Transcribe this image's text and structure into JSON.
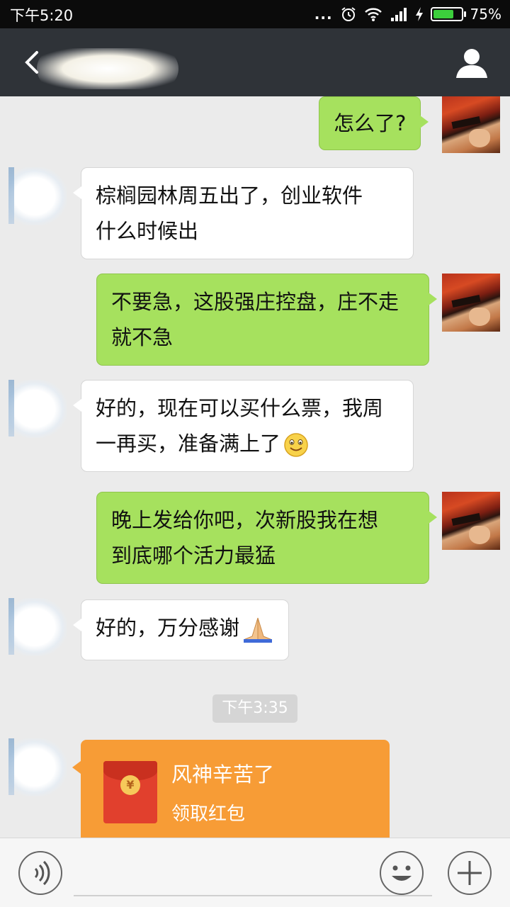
{
  "status_bar": {
    "time": "下午5:20",
    "signal_dots": "...",
    "battery_text": "75%",
    "battery_level": 0.75
  },
  "header": {
    "back_icon": "back-arrow-icon",
    "title": "",
    "profile_icon": "person-icon"
  },
  "messages": [
    {
      "side": "me",
      "text": "怎么了?"
    },
    {
      "side": "them",
      "lines": [
        "棕榈园林周五出了，创业软件",
        "什么时候出"
      ]
    },
    {
      "side": "me",
      "lines": [
        "不要急，这股强庄控盘，庄不走",
        "就不急"
      ]
    },
    {
      "side": "them",
      "lines": [
        "好的，现在可以买什么票，我周",
        "一再买，准备满上了"
      ],
      "emoji": "smile-emoji"
    },
    {
      "side": "me",
      "lines": [
        "晚上发给你吧，次新股我在想",
        "到底哪个活力最猛"
      ]
    },
    {
      "side": "them",
      "text": "好的，万分感谢",
      "emoji": "praying-hands-emoji"
    }
  ],
  "timestamp": "下午3:35",
  "red_packet": {
    "title": "风神辛苦了",
    "subtitle": "领取红包",
    "coin_symbol": "¥"
  },
  "input_bar": {
    "voice_icon": "voice-icon",
    "emoji_icon": "emoji-icon",
    "plus_icon": "plus-icon"
  },
  "colors": {
    "my_bubble": "#a6e15e",
    "their_bubble": "#ffffff",
    "red_packet": "#f79c36",
    "title_bar": "#2f3338"
  }
}
